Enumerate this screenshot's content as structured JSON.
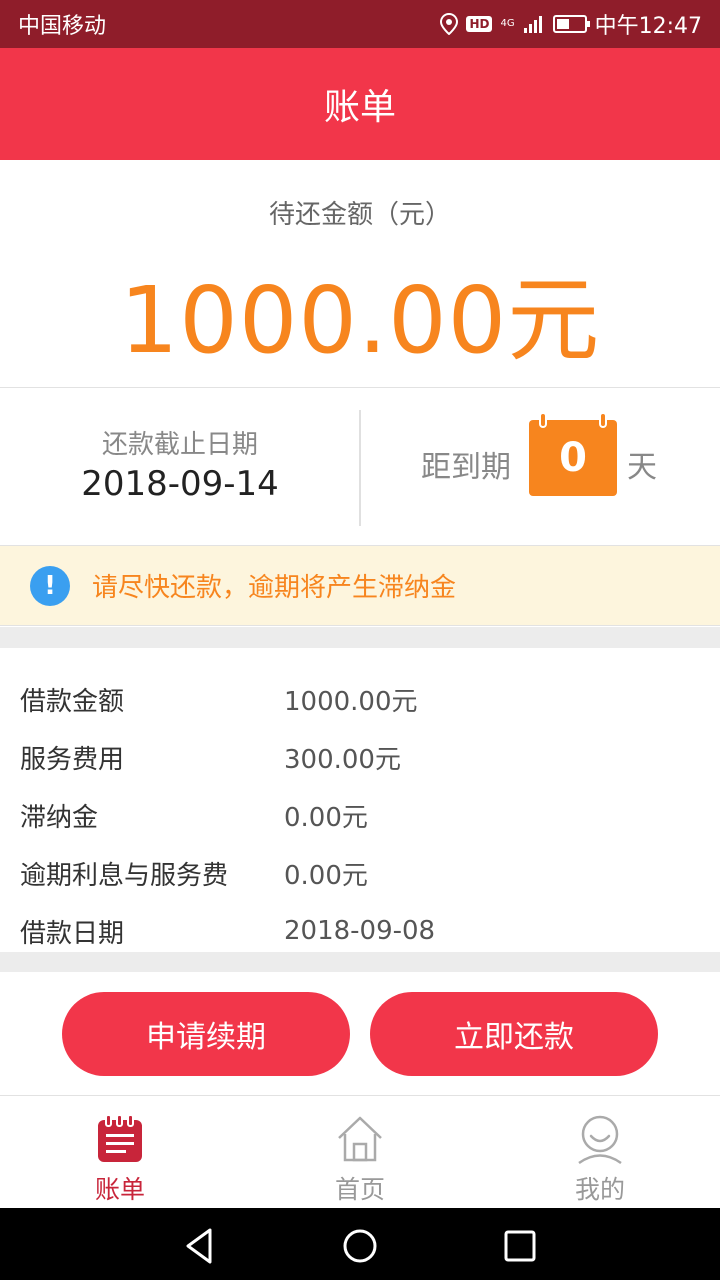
{
  "status_bar": {
    "carrier": "中国移动",
    "hd": "HD",
    "network": "4G",
    "time": "中午12:47"
  },
  "header": {
    "title": "账单"
  },
  "amount": {
    "label": "待还金额（元）",
    "value": "1000.00元",
    "accent_color": "#f7851e"
  },
  "due": {
    "label": "还款截止日期",
    "date": "2018-09-14",
    "countdown_prefix": "距到期",
    "days": "0",
    "days_unit": "天"
  },
  "notice": {
    "icon": "info-icon",
    "text": "请尽快还款，逾期将产生滞纳金"
  },
  "details": [
    {
      "label": "借款金额",
      "value": "1000.00元"
    },
    {
      "label": "服务费用",
      "value": "300.00元"
    },
    {
      "label": "滞纳金",
      "value": "0.00元"
    },
    {
      "label": "逾期利息与服务费",
      "value": "0.00元"
    },
    {
      "label": "借款日期",
      "value": "2018-09-08"
    }
  ],
  "actions": {
    "renew_label": "申请续期",
    "repay_label": "立即还款",
    "button_color": "#f2364a"
  },
  "tabs": [
    {
      "label": "账单",
      "icon": "bill-icon",
      "active": true
    },
    {
      "label": "首页",
      "icon": "home-icon",
      "active": false
    },
    {
      "label": "我的",
      "icon": "profile-icon",
      "active": false
    }
  ],
  "nav": {
    "back": "back-icon",
    "home": "home-circle-icon",
    "recents": "recents-icon"
  }
}
